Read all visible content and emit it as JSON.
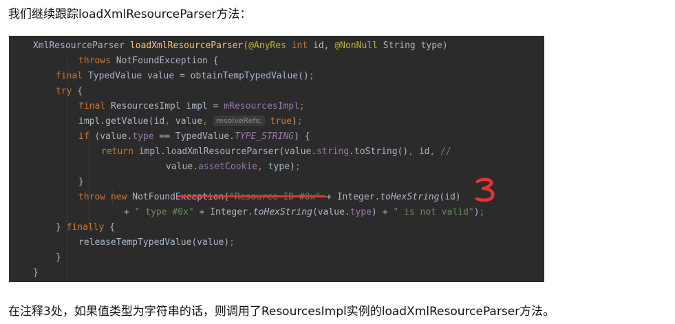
{
  "intro_text": "我们继续跟踪loadXmlResourceParser方法：",
  "outro_text": "在注释3处，如果值类型为字符串的话，则调用了ResourcesImpl实例的loadXmlResourceParser方法。",
  "annotation_mark": "3",
  "accent_colors": {
    "background": "#2b2b2b",
    "keyword": "#cc7832",
    "method": "#ffc66d",
    "annotation": "#bbb529",
    "field": "#9876aa",
    "string": "#6a8759",
    "default": "#a9b7c6",
    "marker": "#e8322e"
  },
  "code": {
    "l1": {
      "ret_type": "XmlResourceParser ",
      "method_name": "loadXmlResourceParser",
      "open": "(",
      "ann1": "@AnyRes",
      "kw_int": " int",
      "p1": " id, ",
      "ann2": "@NonNull",
      "p2": " String type)"
    },
    "l2": {
      "throws_kw": "throws",
      "rest": " NotFoundException {"
    },
    "l3": {
      "final_kw": "final",
      "rest": " TypedValue value = obtainTempTypedValue()",
      "semi": ";"
    },
    "l4": {
      "try_kw": "try",
      "rest": " {"
    },
    "l5": {
      "final_kw": "final",
      "rest": " ResourcesImpl impl = ",
      "field": "mResourcesImpl",
      "semi": ";"
    },
    "l6": {
      "a": "impl.getValue(id",
      "c1": ",",
      "b": " value",
      "c2": ",",
      "hint": "resolveRefs:",
      "kw_true": "true",
      "end": ")",
      "semi": ";"
    },
    "l7": {
      "if_kw": "if",
      "a": " (value.",
      "field": "type",
      "b": " == TypedValue.",
      "static_field": "TYPE_STRING",
      "c": ") {"
    },
    "l8": {
      "return_kw": "return",
      "a": " impl.",
      "method": "loadXmlResourceParser",
      "b": "(value.",
      "field": "string",
      "c": ".toString()",
      "comma1": ",",
      "d": " id",
      "comma2": ",",
      "comment": " //"
    },
    "l9": {
      "a": "value.",
      "field": "assetCookie",
      "comma": ",",
      "b": " type)",
      "semi": ";"
    },
    "l10": {
      "brace": "}"
    },
    "l11": {
      "throw_kw": "throw",
      "new_kw": " new",
      "a": " NotFoundException(",
      "str1": "\"Resource ID #0x\"",
      "b": " + Integer.",
      "static_method": "toHexString",
      "c": "(id)"
    },
    "l12": {
      "a": "+ ",
      "str1": "\" type #0x\"",
      "b": " + Integer.",
      "static_method": "toHexString",
      "c": "(value.",
      "field": "type",
      "d": ") + ",
      "str2": "\" is not valid\"",
      "e": ")",
      "semi": ";"
    },
    "l13": {
      "a": "} ",
      "finally_kw": "finally",
      "b": " {"
    },
    "l14": {
      "a": "releaseTempTypedValue(value)",
      "semi": ";"
    },
    "l15": {
      "brace": "}"
    },
    "l16": {
      "brace": "}"
    }
  }
}
